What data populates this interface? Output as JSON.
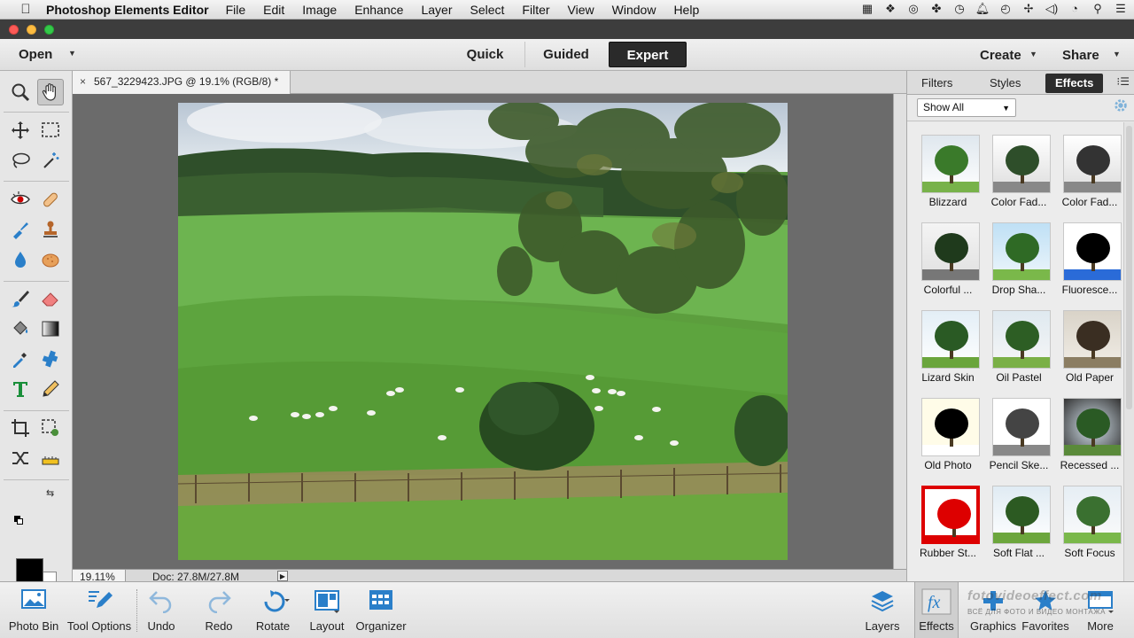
{
  "menubar": {
    "app_name": "Photoshop Elements Editor",
    "items": [
      "File",
      "Edit",
      "Image",
      "Enhance",
      "Layer",
      "Select",
      "Filter",
      "View",
      "Window",
      "Help"
    ]
  },
  "topbar": {
    "open_label": "Open",
    "modes": [
      "Quick",
      "Guided",
      "Expert"
    ],
    "active_mode": "Expert",
    "create_label": "Create",
    "share_label": "Share"
  },
  "document": {
    "tab_title": "567_3229423.JPG @ 19.1% (RGB/8) *",
    "zoom": "19.11%",
    "doc_size": "Doc: 27.8M/27.8M"
  },
  "panel": {
    "tabs": [
      "Filters",
      "Styles",
      "Effects"
    ],
    "active_tab": "Effects",
    "filter_select": "Show All",
    "effects": [
      "Blizzard",
      "Color Fad...",
      "Color Fad...",
      "Colorful ...",
      "Drop Sha...",
      "Fluoresce...",
      "Lizard Skin",
      "Oil Pastel",
      "Old Paper",
      "Old Photo",
      "Pencil Ske...",
      "Recessed ...",
      "Rubber St...",
      "Soft Flat ...",
      "Soft Focus"
    ]
  },
  "bottombar": {
    "left_buttons": [
      "Photo Bin",
      "Tool Options",
      "Undo",
      "Redo",
      "Rotate",
      "Layout",
      "Organizer"
    ],
    "right_buttons": [
      "Layers",
      "Effects",
      "Graphics",
      "Favorites",
      "More"
    ]
  },
  "watermark": {
    "line1": "fotovideoeffect.com",
    "line2": "ВСЁ ДЛЯ ФОТО И ВИДЕО МОНТАЖА"
  },
  "colors": {
    "active_tab_bg": "#2a2a2a",
    "icon_blue": "#2a7fc9",
    "foreground": "#000000",
    "background": "#ffffff"
  }
}
